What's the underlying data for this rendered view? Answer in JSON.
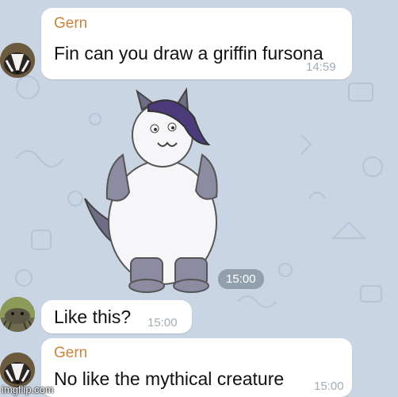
{
  "colors": {
    "background": "#c9d5e3",
    "bubble": "#ffffff",
    "sender": "#c9853a",
    "timestamp": "#a4acb4",
    "pill": "#647484"
  },
  "messages": [
    {
      "sender": "Gern",
      "text": "Fin can you draw a griffin fursona",
      "time": "14:59",
      "avatar": "badger-avatar"
    },
    {
      "sender": "",
      "type": "sticker",
      "sticker": "cat-fursona-drawing",
      "time": "15:00"
    },
    {
      "sender": "",
      "text": "Like this?",
      "time": "15:00",
      "avatar": "catfish-avatar"
    },
    {
      "sender": "Gern",
      "text": "No like the mythical creature",
      "time": "15:00",
      "avatar": "badger-avatar"
    }
  ],
  "watermark": "imgflip.com"
}
